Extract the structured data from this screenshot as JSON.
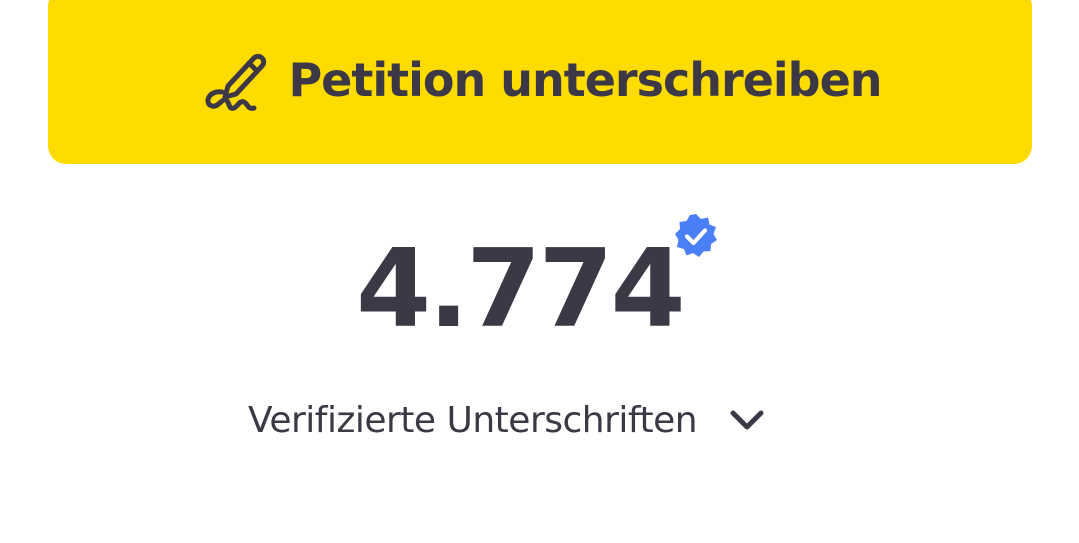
{
  "sign_button": {
    "label": "Petition unterschreiben",
    "icon": "pen-signature-icon",
    "background_color": "#ffdc00",
    "text_color": "#3d3846"
  },
  "counter": {
    "value": "4.774",
    "badge_icon": "verified-check-badge-icon",
    "badge_color": "#4a7ff7"
  },
  "signatures_toggle": {
    "label": "Verifizierte Unterschriften",
    "icon": "chevron-down-icon"
  }
}
